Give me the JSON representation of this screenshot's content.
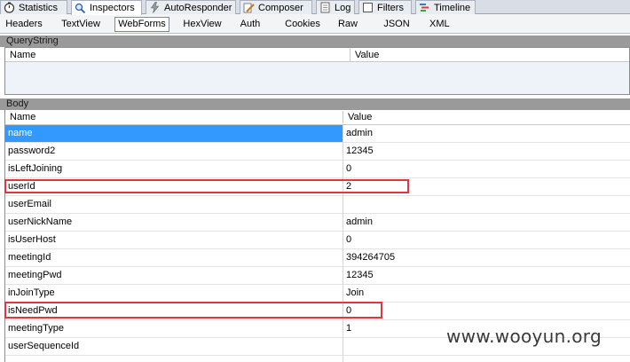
{
  "top_tabs": [
    {
      "label": "Statistics",
      "icon": "stopwatch-icon"
    },
    {
      "label": "Inspectors",
      "icon": "magnifier-icon",
      "active": true
    },
    {
      "label": "AutoResponder",
      "icon": "lightning-icon"
    },
    {
      "label": "Composer",
      "icon": "pencil-icon"
    },
    {
      "label": "Log",
      "icon": "log-page-icon"
    },
    {
      "label": "Filters",
      "icon": "checkbox-icon"
    },
    {
      "label": "Timeline",
      "icon": "timeline-icon"
    }
  ],
  "sub_tabs": [
    "Headers",
    "TextView",
    "WebForms",
    "HexView",
    "Auth",
    "Cookies",
    "Raw",
    "JSON",
    "XML"
  ],
  "sub_tab_active": "WebForms",
  "querystring": {
    "title": "QueryString",
    "columns": [
      "Name",
      "Value"
    ]
  },
  "body": {
    "title": "Body",
    "columns": [
      "Name",
      "Value"
    ],
    "rows": [
      {
        "name": "name",
        "value": "admin"
      },
      {
        "name": "password2",
        "value": "12345"
      },
      {
        "name": "isLeftJoining",
        "value": "0"
      },
      {
        "name": "userId",
        "value": "2"
      },
      {
        "name": "userEmail",
        "value": ""
      },
      {
        "name": "userNickName",
        "value": "admin"
      },
      {
        "name": "isUserHost",
        "value": "0"
      },
      {
        "name": "meetingId",
        "value": "394264705"
      },
      {
        "name": "meetingPwd",
        "value": "12345"
      },
      {
        "name": "inJoinType",
        "value": "Join"
      },
      {
        "name": "isNeedPwd",
        "value": "0"
      },
      {
        "name": "meetingType",
        "value": "1"
      },
      {
        "name": "userSequenceId",
        "value": ""
      },
      {
        "name": "",
        "value": ""
      }
    ],
    "selected_row": 0,
    "highlighted_rows": [
      3,
      10
    ]
  },
  "watermark": "www.wooyun.org",
  "colors": {
    "selection": "#3399ff",
    "highlight": "#e1363f",
    "section_header": "#9a9a9a"
  }
}
